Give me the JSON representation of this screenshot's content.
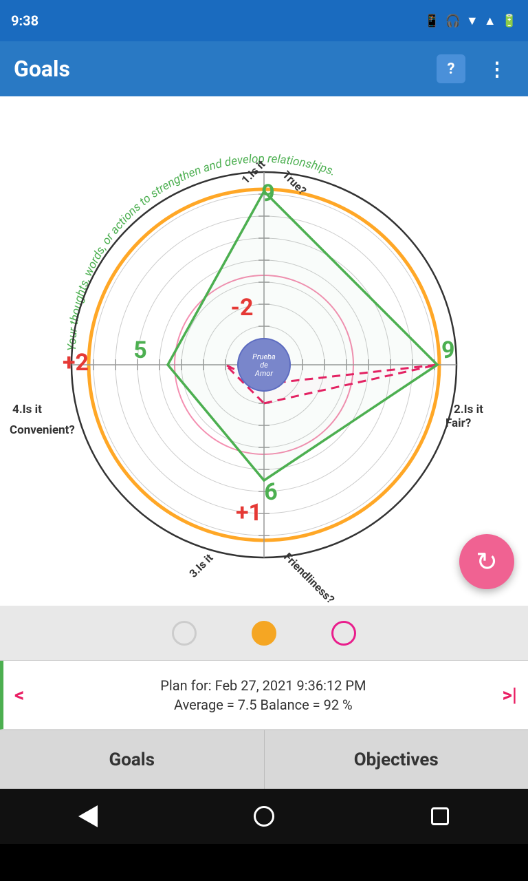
{
  "statusBar": {
    "time": "9:38",
    "icons": [
      "sim",
      "headset",
      "wifi",
      "signal",
      "battery"
    ]
  },
  "appBar": {
    "title": "Goals",
    "helpIcon": "?",
    "moreIcon": "⋮"
  },
  "chart": {
    "centerLabel": "Prueba\nde\nAmor",
    "outerText": "Your thoughts, words, or actions to strengthen and develop relationships.",
    "axes": [
      {
        "label": "1.Is it",
        "sublabel": "True?",
        "position": "top",
        "greenValue": "9",
        "redValue": "-2"
      },
      {
        "label": "2.Is it",
        "sublabel": "Fair?",
        "position": "right",
        "greenValue": "9",
        "redValue": ""
      },
      {
        "label": "3.Is it",
        "sublabel": "Friendliness?",
        "position": "bottom",
        "greenValue": "6",
        "redValue": "+1"
      },
      {
        "label": "4.Is it",
        "sublabel": "Convenient?",
        "position": "left",
        "greenValue": "5",
        "redValue": "+2"
      }
    ]
  },
  "pagination": {
    "dots": [
      "empty",
      "active",
      "pink"
    ]
  },
  "infoBar": {
    "planDate": "Plan for: Feb 27, 2021 9:36:12 PM",
    "stats": "Average = 7.5 Balance = 92 %",
    "prevArrow": "<",
    "nextArrow": ">|"
  },
  "tabs": [
    {
      "id": "goals",
      "label": "Goals",
      "active": false
    },
    {
      "id": "objectives",
      "label": "Objectives",
      "active": true
    }
  ],
  "navBar": {
    "back": "back",
    "home": "home",
    "recents": "recents"
  },
  "fab": {
    "icon": "↻"
  }
}
